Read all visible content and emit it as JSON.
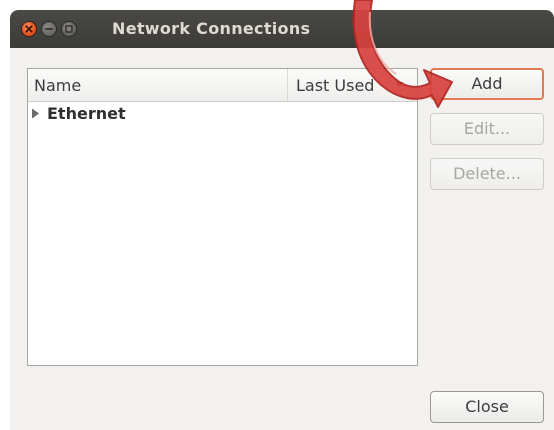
{
  "window": {
    "title": "Network Connections"
  },
  "list": {
    "columns": [
      "Name",
      "Last Used"
    ],
    "rows": [
      {
        "label": "Ethernet",
        "expanded": false
      }
    ]
  },
  "buttons": {
    "add": {
      "label": "Add",
      "enabled": true,
      "highlighted": true
    },
    "edit": {
      "label": "Edit...",
      "enabled": false
    },
    "delete": {
      "label": "Delete...",
      "enabled": false
    },
    "close": {
      "label": "Close",
      "enabled": true
    }
  },
  "colors": {
    "titlebar": "#3c3b37",
    "close_button": "#e8541f",
    "annotation_arrow": "#c9302c"
  },
  "icons": {
    "close": "close-icon",
    "minimize": "minimize-icon",
    "maximize": "maximize-icon",
    "sort": "sort-descending-icon",
    "expander": "expander-right-icon",
    "annotation": "annotation-arrow-icon"
  }
}
